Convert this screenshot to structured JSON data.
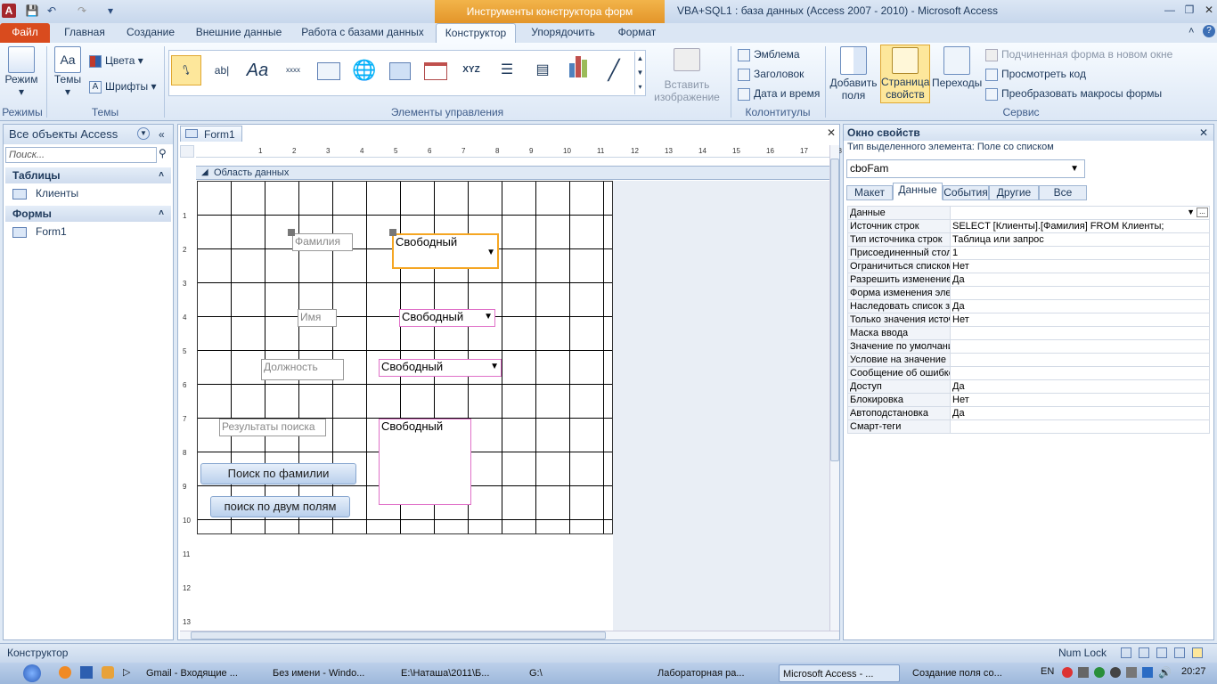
{
  "titlebar": {
    "contextual": "Инструменты конструктора форм",
    "title": "VBA+SQL1 : база данных (Access 2007 - 2010)  -  Microsoft Access"
  },
  "tabs": [
    "Файл",
    "Главная",
    "Создание",
    "Внешние данные",
    "Работа с базами данных",
    "Конструктор",
    "Упорядочить",
    "Формат"
  ],
  "ribbon": {
    "views": {
      "mode": "Режим",
      "label": "Режимы"
    },
    "themes": {
      "themes": "Темы",
      "colors": "Цвета",
      "fonts": "Шрифты",
      "label": "Темы"
    },
    "controls": {
      "label": "Элементы управления",
      "insert_image": "Вставить изображение",
      "textbox": "ab|",
      "font": "Aa",
      "xxxx": "xxxx",
      "xyz": "XYZ"
    },
    "header_footer": {
      "logo": "Эмблема",
      "title": "Заголовок",
      "date_time": "Дата и время",
      "label": "Колонтитулы"
    },
    "tools": {
      "add_fields": "Добавить поля",
      "property_sheet": "Страница свойств",
      "tab_order": "Переходы",
      "subform": "Подчиненная форма в новом окне",
      "view_code": "Просмотреть код",
      "convert_macros": "Преобразовать макросы формы",
      "label": "Сервис"
    }
  },
  "nav": {
    "header": "Все объекты Access",
    "search_placeholder": "Поиск...",
    "groups": [
      {
        "name": "Таблицы",
        "items": [
          "Клиенты"
        ]
      },
      {
        "name": "Формы",
        "items": [
          "Form1"
        ]
      }
    ]
  },
  "document": {
    "tab": "Form1",
    "section": "Область данных",
    "ruler_h": [
      "1",
      "2",
      "3",
      "4",
      "5",
      "6",
      "7",
      "8",
      "9",
      "10",
      "11",
      "12",
      "13",
      "14",
      "15",
      "16",
      "17",
      "18"
    ],
    "ruler_v": [
      "1",
      "2",
      "3",
      "4",
      "5",
      "6",
      "7",
      "8",
      "9",
      "10",
      "11",
      "12",
      "13"
    ],
    "labels": {
      "familia": "Фамилия",
      "imya": "Имя",
      "dolzhnost": "Должность",
      "results": "Результаты поиска"
    },
    "combos": {
      "c1": "Свободный",
      "c2": "Свободный",
      "c3": "Свободный"
    },
    "listbox": "Свободный",
    "buttons": {
      "search_familia": "Поиск по фамилии",
      "search_two": "поиск по двум полям"
    }
  },
  "props": {
    "title": "Окно свойств",
    "selection_type": "Тип выделенного элемента:  Поле со списком",
    "selected": "cboFam",
    "tabs": [
      "Макет",
      "Данные",
      "События",
      "Другие",
      "Все"
    ],
    "rows": [
      [
        "Данные",
        ""
      ],
      [
        "Источник строк",
        "SELECT [Клиенты].[Фамилия] FROM Клиенты;"
      ],
      [
        "Тип источника строк",
        "Таблица или запрос"
      ],
      [
        "Присоединенный столбец",
        "1"
      ],
      [
        "Ограничиться списком",
        "Нет"
      ],
      [
        "Разрешить изменение списка",
        "Да"
      ],
      [
        "Форма изменения элементов списка",
        ""
      ],
      [
        "Наследовать список значений",
        "Да"
      ],
      [
        "Только значения источника строк",
        "Нет"
      ],
      [
        "Маска ввода",
        ""
      ],
      [
        "Значение по умолчанию",
        ""
      ],
      [
        "Условие на значение",
        ""
      ],
      [
        "Сообщение об ошибке",
        ""
      ],
      [
        "Доступ",
        "Да"
      ],
      [
        "Блокировка",
        "Нет"
      ],
      [
        "Автоподстановка",
        "Да"
      ],
      [
        "Смарт-теги",
        ""
      ]
    ]
  },
  "status": {
    "mode": "Конструктор",
    "numlock": "Num Lock"
  },
  "taskbar": {
    "items": [
      "Gmail - Входящие ...",
      "Без имени - Windo...",
      "E:\\Наташа\\2011\\Б...",
      "G:\\",
      "Лабораторная ра...",
      "Microsoft Access - ...",
      "Создание поля со..."
    ],
    "lang": "EN",
    "clock": "20:27"
  }
}
